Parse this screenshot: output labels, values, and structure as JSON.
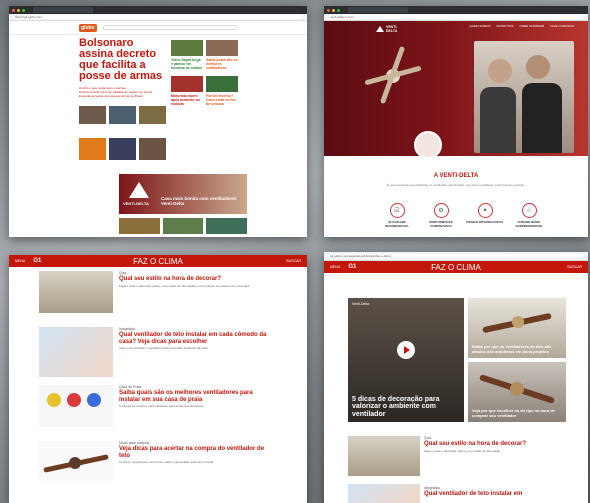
{
  "s1": {
    "url": "https://g1.globo.com",
    "headline": "Bolsonaro assina decreto que facilita a posse de armas",
    "bullets": [
      "Confira o que muda após o decreto",
      "Decreto amplia prazo de validade do registro de armas",
      "Entenda as regras da posse de armas no Brasil"
    ],
    "side_titles": [
      "Vídeo flagra briga e pânico em terminal de ônibus",
      "Saiba quais são os melhores ventiladores",
      "Motorista morre após acidente em rodovia",
      "Fim do inverno? Calor volta no fim de semana"
    ],
    "ad_brand": "VENTI-DELTA",
    "ad_tagline": "Casa mais bonita com ventiladores Venti-Delta"
  },
  "s2": {
    "url": "venti-delta.com.br",
    "brand": "VENTI-DELTA",
    "nav": [
      "QUEM SOMOS",
      "PRODUTOS",
      "ONDE COMPRAR",
      "FALE CONOSCO"
    ],
    "section_title": "A VENTI-DELTA",
    "section_sub": "É uma empresa especializada em ventilação e iluminação, que reúne qualidade, performance e design.",
    "features": [
      {
        "label": "QUALIDADE INCOMPARÁVEL",
        "icon": "award-icon",
        "glyph": "☑"
      },
      {
        "label": "PERFORMANCE COMPROVADA",
        "icon": "gears-icon",
        "glyph": "⚙"
      },
      {
        "label": "DESIGN INTERNACIONAL",
        "icon": "bulb-icon",
        "glyph": "✦"
      },
      {
        "label": "DURABILIDADE SURPREENDENTE",
        "icon": "star-icon",
        "glyph": "☆"
      }
    ]
  },
  "s3": {
    "menu": "MENU",
    "logo": "G1",
    "section": "FAZ O CLIMA",
    "search": "BUSCAR",
    "items": [
      {
        "kicker": "Quiz",
        "title": "Qual seu estilo na hora de decorar?",
        "summary": "Faça o teste e descubra qual é o seu estilo de decoração e como deixar sua casa com a sua cara."
      },
      {
        "kicker": "Infográfico",
        "title": "Qual ventilador de teto instalar em cada cômodo da casa? Veja dicas para escolher",
        "summary": "Veja como escolher o ventilador ideal para cada ambiente da casa."
      },
      {
        "kicker": "Casa de Praia",
        "title": "Saiba quais são os melhores ventiladores para instalar em sua casa de praia",
        "summary": "Conheça os modelos mais indicados para ambientes litorâneos."
      },
      {
        "kicker": "Dicas para comprar",
        "title": "Veja dicas para acertar na compra do ventilador de teto",
        "summary": "Conforto, segurança e economia: saiba o que avaliar antes de comprar."
      }
    ]
  },
  "s4": {
    "menu": "MENU",
    "logo": "G1",
    "section": "FAZ O CLIMA",
    "search": "BUSCAR",
    "main_kicker": "Venti-Delta",
    "main_title": "5 dicas de decoração para valorizar o ambiente com ventilador",
    "side1_title": "Saiba por que os ventiladores de teto são aliados dos arquitetos em bons projetos",
    "side2_title": "Veja por que escolher os do tipo na hora de comprar seu ventilador",
    "item_kicker": "Quiz",
    "item_title": "Qual seu estilo na hora de decorar?",
    "item_summary": "Faça o teste e descubra qual é o seu estilo de decoração.",
    "item2_kicker": "Infográfico",
    "item2_title": "Qual ventilador de teto instalar em"
  }
}
